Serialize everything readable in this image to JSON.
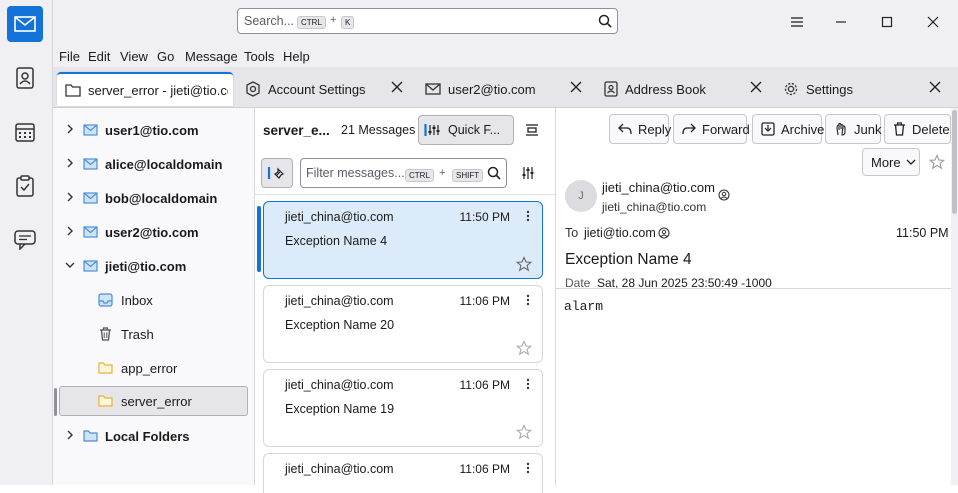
{
  "spaces": [
    {
      "name": "mail",
      "icon": "mail-icon",
      "active": true
    },
    {
      "name": "address-book",
      "icon": "address-book-icon"
    },
    {
      "name": "calendar",
      "icon": "calendar-icon"
    },
    {
      "name": "tasks",
      "icon": "tasks-icon"
    },
    {
      "name": "chat",
      "icon": "chat-icon"
    }
  ],
  "search": {
    "placeholder": "Search...",
    "shortcut_key1": "CTRL",
    "plus": "+",
    "shortcut_key2": "K"
  },
  "menu": [
    "File",
    "Edit",
    "View",
    "Go",
    "Message",
    "Tools",
    "Help"
  ],
  "tabs": [
    {
      "label": "server_error - jieti@tio.com",
      "icon": "folder-icon",
      "active": true
    },
    {
      "label": "Account Settings",
      "icon": "account-settings-icon"
    },
    {
      "label": "user2@tio.com",
      "icon": "mail-icon"
    },
    {
      "label": "Address Book",
      "icon": "address-book-icon"
    },
    {
      "label": "Settings",
      "icon": "gear-icon"
    }
  ],
  "folders": [
    {
      "label": "user1@tio.com",
      "type": "account"
    },
    {
      "label": "alice@localdomain",
      "type": "account"
    },
    {
      "label": "bob@localdomain",
      "type": "account"
    },
    {
      "label": "user2@tio.com",
      "type": "account"
    },
    {
      "label": "jieti@tio.com",
      "type": "account",
      "expanded": true
    },
    {
      "label": "Inbox",
      "type": "inbox"
    },
    {
      "label": "Trash",
      "type": "trash"
    },
    {
      "label": "app_error",
      "type": "folder"
    },
    {
      "label": "server_error",
      "type": "folder",
      "selected": true
    },
    {
      "label": "Local Folders",
      "type": "local"
    }
  ],
  "thread_header": {
    "folder_name": "server_e...",
    "count": "21 Messages",
    "quick_filter": "Quick F..."
  },
  "filter": {
    "placeholder": "Filter messages...",
    "key1": "CTRL",
    "plus": "+",
    "key2": "SHIFT"
  },
  "messages": [
    {
      "sender": "jieti_china@tio.com",
      "time": "11:50 PM",
      "subject": "Exception Name 4",
      "selected": true
    },
    {
      "sender": "jieti_china@tio.com",
      "time": "11:06 PM",
      "subject": "Exception Name 20"
    },
    {
      "sender": "jieti_china@tio.com",
      "time": "11:06 PM",
      "subject": "Exception Name 19"
    },
    {
      "sender": "jieti_china@tio.com",
      "time": "11:06 PM",
      "subject": ""
    }
  ],
  "header_buttons": {
    "reply": "Reply",
    "forward": "Forward",
    "archive": "Archive",
    "junk": "Junk",
    "delete": "Delete",
    "more": "More"
  },
  "message": {
    "avatar_initial": "J",
    "from_name": "jieti_china@tio.com",
    "from_email": "jieti_china@tio.com",
    "to_label": "To",
    "to": "jieti@tio.com",
    "time": "11:50 PM",
    "subject": "Exception Name 4",
    "date_label": "Date",
    "date": "Sat, 28 Jun 2025 23:50:49 -1000",
    "body": "alarm"
  },
  "colors": {
    "accent": "#1373d9",
    "folder_yellow": "#e8b23a",
    "mail_blue": "#4a8fd9"
  }
}
